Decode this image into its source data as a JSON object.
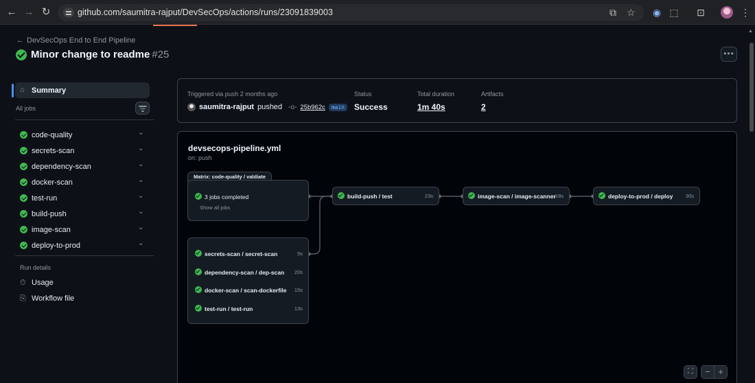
{
  "browser": {
    "url": "github.com/saumitra-rajput/DevSecOps/actions/runs/23091839003"
  },
  "header": {
    "back_label": "DevSecOps End to End Pipeline",
    "title": "Minor change to readme",
    "run_number": "#25"
  },
  "sidebar": {
    "summary_label": "Summary",
    "all_jobs_label": "All jobs",
    "jobs": [
      {
        "label": "code-quality"
      },
      {
        "label": "secrets-scan"
      },
      {
        "label": "dependency-scan"
      },
      {
        "label": "docker-scan"
      },
      {
        "label": "test-run"
      },
      {
        "label": "build-push"
      },
      {
        "label": "image-scan"
      },
      {
        "label": "deploy-to-prod"
      }
    ],
    "run_details_label": "Run details",
    "usage_label": "Usage",
    "workflow_file_label": "Workflow file"
  },
  "summary": {
    "trigger_label": "Triggered via push 2 months ago",
    "actor": "saumitra-rajput",
    "actor_verb": "pushed",
    "commit_sha": "25b962c",
    "branch": "main",
    "status_label": "Status",
    "status_value": "Success",
    "duration_label": "Total duration",
    "duration_value": "1m 40s",
    "artifacts_label": "Artifacts",
    "artifacts_value": "2"
  },
  "graph": {
    "workflow_file": "devsecops-pipeline.yml",
    "trigger": "on: push",
    "matrix_tag": "Matrix: code-quality / valdiate",
    "matrix_summary": "3 jobs completed",
    "show_all": "Show all jobs",
    "scan_jobs": [
      {
        "label": "secrets-scan / secret-scan",
        "duration": "5s"
      },
      {
        "label": "dependency-scan / dep-scan",
        "duration": "20s"
      },
      {
        "label": "docker-scan / scan-dockerfile",
        "duration": "15s"
      },
      {
        "label": "test-run / test-run",
        "duration": "13s"
      }
    ],
    "build": {
      "label": "build-push / test",
      "duration": "23s"
    },
    "image": {
      "label": "image-scan / image-scanner",
      "duration": "18s"
    },
    "deploy": {
      "label": "deploy-to-prod / deploy",
      "duration": "30s"
    }
  },
  "colors": {
    "success": "#3fb950",
    "accent": "#4493f8",
    "background": "#0d1117"
  }
}
